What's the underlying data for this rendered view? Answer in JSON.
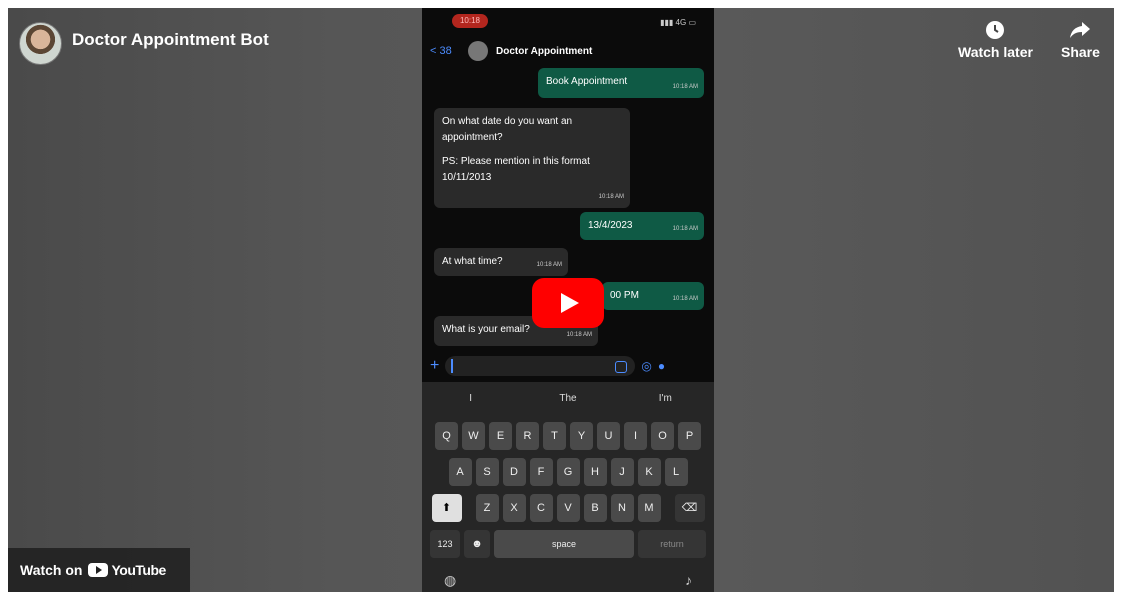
{
  "video": {
    "title": "Doctor Appointment Bot",
    "watch_later": "Watch later",
    "share": "Share",
    "watch_on": "Watch on",
    "youtube": "YouTube"
  },
  "phone": {
    "status_time": "10:18",
    "status_right": "4G",
    "back_count": "38",
    "contact_name": "Doctor Appointment",
    "messages": [
      {
        "dir": "out",
        "text": "Book Appointment",
        "time": "10:18 AM"
      },
      {
        "dir": "in",
        "text": "On what date do you want an appointment?",
        "text2": "PS: Please mention in this format 10/11/2013",
        "time": "10:18 AM"
      },
      {
        "dir": "out",
        "text": "13/4/2023",
        "time": "10:18 AM"
      },
      {
        "dir": "in",
        "text": "At what time?",
        "time": "10:18 AM"
      },
      {
        "dir": "out",
        "text": "00 PM",
        "time": "10:18 AM"
      },
      {
        "dir": "in",
        "text": "What is your email?",
        "time": "10:18 AM"
      }
    ],
    "suggestions": [
      "I",
      "The",
      "I'm"
    ],
    "keys_row1": [
      "Q",
      "W",
      "E",
      "R",
      "T",
      "Y",
      "U",
      "I",
      "O",
      "P"
    ],
    "keys_row2": [
      "A",
      "S",
      "D",
      "F",
      "G",
      "H",
      "J",
      "K",
      "L"
    ],
    "keys_row3": [
      "Z",
      "X",
      "C",
      "V",
      "B",
      "N",
      "M"
    ],
    "key_123": "123",
    "key_space": "space",
    "key_return": "return"
  }
}
